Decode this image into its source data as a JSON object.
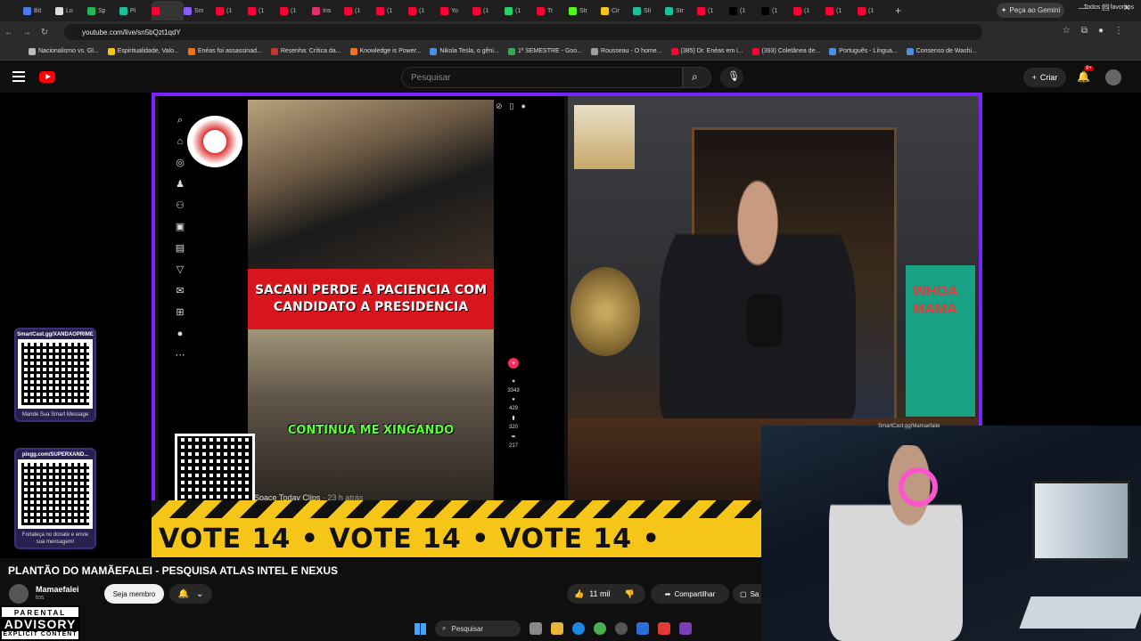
{
  "browser": {
    "tabs": [
      {
        "label": "Bit",
        "color": "#4a7bf7"
      },
      {
        "label": "Lo",
        "color": "#dddddd"
      },
      {
        "label": "Sp",
        "color": "#1db954"
      },
      {
        "label": "Pi",
        "color": "#19c29a"
      },
      {
        "label": "",
        "color": "#ff0033",
        "active": true
      },
      {
        "label": "Sm",
        "color": "#8a5cf6"
      },
      {
        "label": "(1",
        "color": "#ff0033"
      },
      {
        "label": "(1",
        "color": "#ff0033"
      },
      {
        "label": "(1",
        "color": "#ff0033"
      },
      {
        "label": "Ins",
        "color": "#e1306c"
      },
      {
        "label": "(1",
        "color": "#ff0033"
      },
      {
        "label": "(1",
        "color": "#ff0033"
      },
      {
        "label": "(1",
        "color": "#ff0033"
      },
      {
        "label": "Yo",
        "color": "#ff0033"
      },
      {
        "label": "(1",
        "color": "#ff0033"
      },
      {
        "label": "(1",
        "color": "#25d366"
      },
      {
        "label": "Tr",
        "color": "#ff0033"
      },
      {
        "label": "Str",
        "color": "#53fc18"
      },
      {
        "label": "Cir",
        "color": "#f5c518"
      },
      {
        "label": "Sti",
        "color": "#19c29a"
      },
      {
        "label": "Str",
        "color": "#19c29a"
      },
      {
        "label": "(1",
        "color": "#ff0033"
      },
      {
        "label": "(1",
        "color": "#000000"
      },
      {
        "label": "(1",
        "color": "#000000"
      },
      {
        "label": "(1",
        "color": "#ff0033"
      },
      {
        "label": "(1",
        "color": "#ff0033"
      },
      {
        "label": "(1",
        "color": "#ff0033"
      }
    ],
    "new_tab": "+",
    "gemini_label": "Peça ao Gemini",
    "url": "youtube.com/live/sn5bQzt1qdY",
    "bookmarks": [
      {
        "label": "Nacionalismo vs. Gl...",
        "color": "#bbbbbb"
      },
      {
        "label": "Espiritualidade, Valo...",
        "color": "#f5c518"
      },
      {
        "label": "Enéas foi assassinad...",
        "color": "#f2711c"
      },
      {
        "label": "Resenha: Crítica da...",
        "color": "#c0392b"
      },
      {
        "label": "Knowledge is Power...",
        "color": "#f2711c"
      },
      {
        "label": "Nikola Tesla, o gêni...",
        "color": "#4a90e2"
      },
      {
        "label": "1º SEMESTRE - Goo...",
        "color": "#34a853"
      },
      {
        "label": "Rousseau - O home...",
        "color": "#9e9e9e"
      },
      {
        "label": "(385) Dr. Enéas em i...",
        "color": "#ff0033"
      },
      {
        "label": "(393) Coletânea de...",
        "color": "#ff0033"
      },
      {
        "label": "Português - Língua...",
        "color": "#4a90e2"
      },
      {
        "label": "Consenso de Washi...",
        "color": "#4a90e2"
      }
    ],
    "bookmarks_all": "Todos os favoritos"
  },
  "youtube": {
    "search_placeholder": "Pesquisar",
    "create_label": "Criar",
    "notif_count": "9+"
  },
  "tiktok_clip": {
    "banner_line1": "SACANI PERDE A PACIENCIA COM",
    "banner_line2": "CANDIDATO A PRESIDENCIA",
    "caption": "CONTINUA ME XINGANDO",
    "credit": "Space Today Clips",
    "credit_time": "· 23 h atrás",
    "likes": "3343",
    "comments": "429",
    "saves": "320",
    "shares": "217"
  },
  "overlay": {
    "vote_text": "VOTE 14  •  VOTE 14  •  VOTE 14  •",
    "donate_top_title": "SmartCast.gg/XANDAOPRIME",
    "donate_top_sub": "Mande Sua Smart Message",
    "donate_bottom_title": "pixgg.com/SUPERXAND...",
    "donate_bottom_sub": "Fortaleça no donate e envie sua mensagem!",
    "poster_text": "WHOA MAMA",
    "cam_label": "SmartCast.gg/Mamaefalei",
    "parental_line1": "PARENTAL",
    "parental_line2": "ADVISORY",
    "parental_line3": "EXPLICIT CONTENT"
  },
  "video": {
    "title": "PLANTÃO DO MAMÃEFALEI - PESQUISA ATLAS INTEL E NEXUS",
    "channel_name": "Mamaefalei",
    "channel_subs": "tos",
    "member_button": "Seja membro",
    "likes": "11 mil",
    "share_label": "Compartilhar",
    "save_label": "Sa"
  },
  "taskbar": {
    "search_label": "Pesquisar"
  }
}
